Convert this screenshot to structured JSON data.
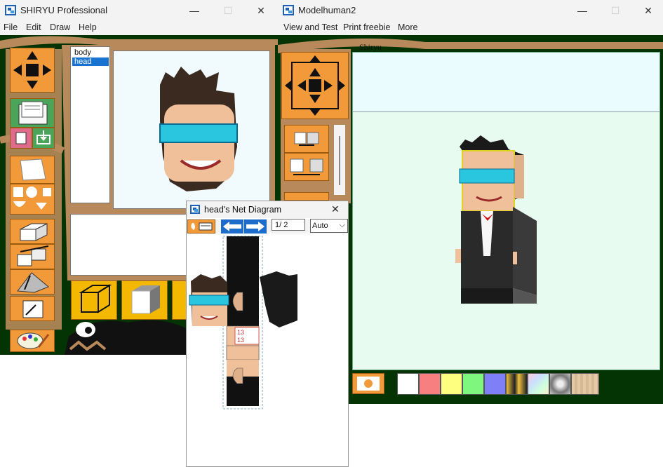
{
  "win1": {
    "title": "SHIRYU Professional",
    "menu": [
      "File",
      "Edit",
      "Draw",
      "Help"
    ],
    "parts_list": [
      "body",
      "head"
    ],
    "selected_part": "head"
  },
  "win2": {
    "title": "Modelhuman2",
    "menu": [
      "View and Test",
      "Print freebie",
      "More"
    ],
    "viewport_label": "Shiryu",
    "swatches": [
      "#ffffff",
      "#f77f7f",
      "#ffff7f",
      "#7ff77f",
      "#7f7ff7"
    ]
  },
  "net": {
    "title": "head's Net Diagram",
    "page": "1/ 2",
    "mode": "Auto",
    "face_numbers": [
      "13",
      "13"
    ]
  },
  "controls": {
    "minimize": "—",
    "maximize": "☐",
    "close": "✕",
    "dropdown": "⌵"
  }
}
